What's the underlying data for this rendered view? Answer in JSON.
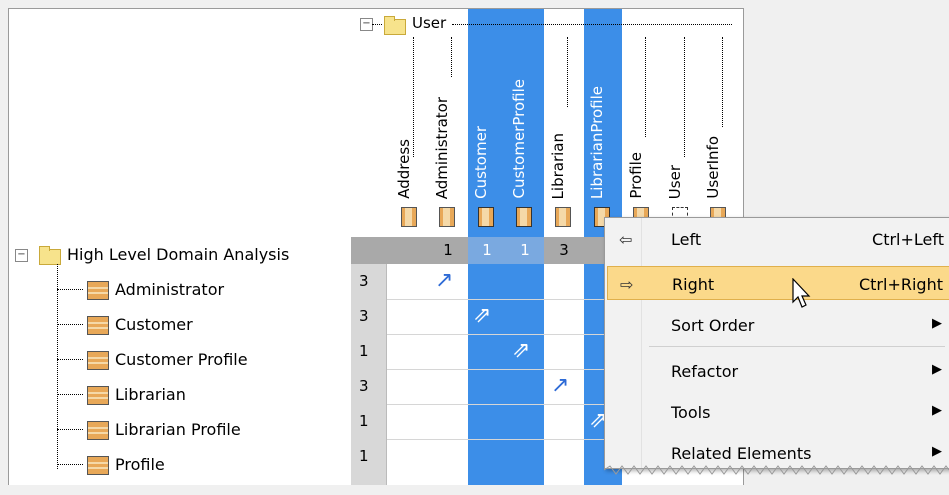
{
  "column_group": {
    "label": "User"
  },
  "columns": [
    {
      "label": "Address",
      "selected": false,
      "icon": "class-icon"
    },
    {
      "label": "Administrator",
      "selected": false,
      "icon": "class-icon"
    },
    {
      "label": "Customer",
      "selected": true,
      "icon": "class-icon"
    },
    {
      "label": "CustomerProfile",
      "selected": true,
      "icon": "class-icon"
    },
    {
      "label": "Librarian",
      "selected": false,
      "icon": "class-icon"
    },
    {
      "label": "LibrarianProfile",
      "selected": true,
      "icon": "class-icon"
    },
    {
      "label": "Profile",
      "selected": false,
      "icon": "class-icon"
    },
    {
      "label": "User",
      "selected": false,
      "icon": "interface-icon"
    },
    {
      "label": "UserInfo",
      "selected": false,
      "icon": "class-icon"
    }
  ],
  "row_group": {
    "label": "High Level Domain Analysis"
  },
  "rows": [
    {
      "label": "Administrator",
      "count": "3"
    },
    {
      "label": "Customer",
      "count": "3"
    },
    {
      "label": "Customer Profile",
      "count": "1"
    },
    {
      "label": "Librarian",
      "count": "3"
    },
    {
      "label": "Librarian Profile",
      "count": "1"
    },
    {
      "label": "Profile",
      "count": "1"
    }
  ],
  "column_counts": [
    "",
    "1",
    "1",
    "1",
    "3"
  ],
  "context_menu": {
    "items": [
      {
        "icon": "arrow-left-icon",
        "label": "Left",
        "shortcut": "Ctrl+Left"
      },
      {
        "icon": "arrow-right-icon",
        "label": "Right",
        "shortcut": "Ctrl+Right",
        "highlighted": true
      },
      {
        "label": "Sort Order",
        "submenu": true
      },
      {
        "label": "Refactor",
        "submenu": true
      },
      {
        "label": "Tools",
        "submenu": true
      },
      {
        "label": "Related Elements",
        "submenu": true
      }
    ]
  },
  "colors": {
    "selection": "#3c8ee8",
    "highlight": "#fbd98a",
    "summary_bar": "#a9a9a9"
  }
}
